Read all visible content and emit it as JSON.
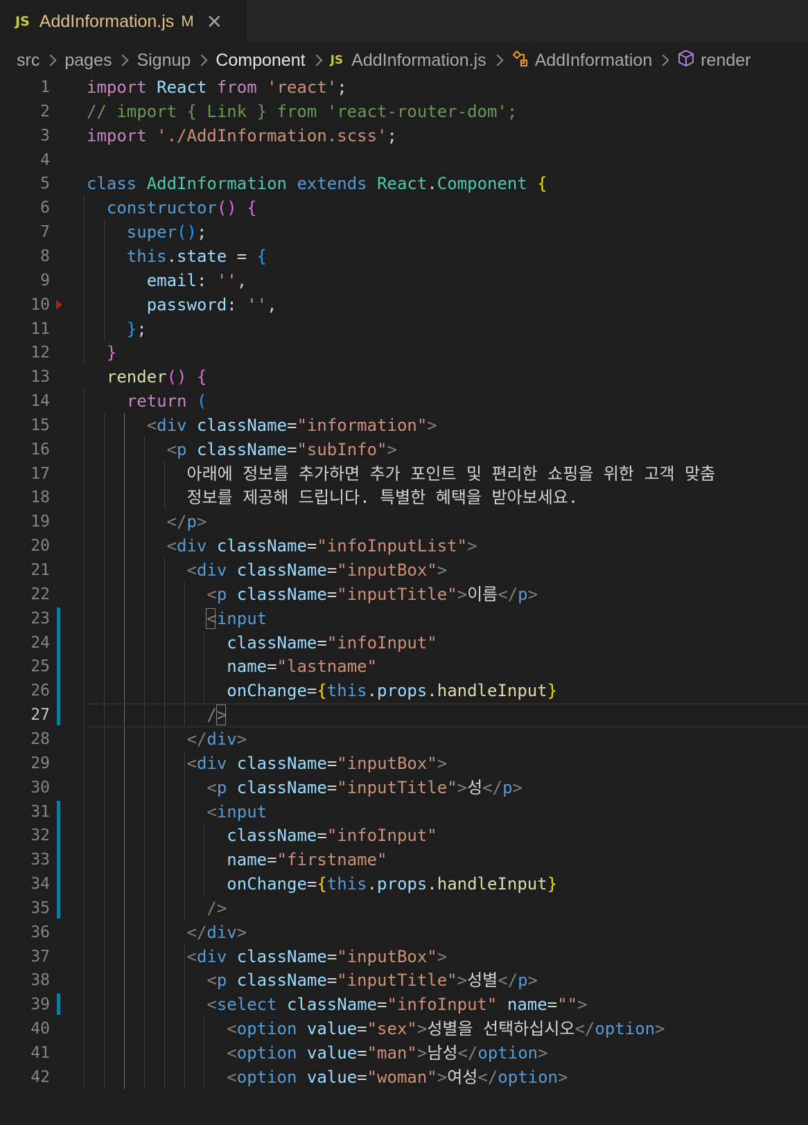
{
  "tab": {
    "icon_label": "JS",
    "title": "AddInformation.js",
    "modified_badge": "M",
    "close_icon": "close-icon"
  },
  "breadcrumb": {
    "items": [
      "src",
      "pages",
      "Signup",
      "Component",
      "AddInformation.js",
      "AddInformation",
      "render"
    ],
    "file_icon_label": "JS",
    "class_icon": "class-symbol-icon",
    "method_icon": "method-cube-icon"
  },
  "colors": {
    "background": "#1e1e1e",
    "tab_modified": "#e2c08d",
    "gutter_modified": "#0c7d9d",
    "js_icon": "#cbcb41"
  },
  "editor": {
    "active_line": 27,
    "lines": [
      "1",
      "2",
      "3",
      "4",
      "5",
      "6",
      "7",
      "8",
      "9",
      "10",
      "11",
      "12",
      "13",
      "14",
      "15",
      "16",
      "17",
      "18",
      "19",
      "20",
      "21",
      "22",
      "23",
      "24",
      "25",
      "26",
      "27",
      "28",
      "29",
      "30",
      "31",
      "32",
      "33",
      "34",
      "35",
      "36",
      "37",
      "38",
      "39",
      "40",
      "41",
      "42"
    ],
    "tokens": [
      [
        [
          "kw",
          "import"
        ],
        [
          "pn",
          " "
        ],
        [
          "vr",
          "React"
        ],
        [
          "pn",
          " "
        ],
        [
          "kw",
          "from"
        ],
        [
          "pn",
          " "
        ],
        [
          "str",
          "'react'"
        ],
        [
          "pn",
          ";"
        ]
      ],
      [
        [
          "com",
          "// import { Link } from 'react-router-dom';"
        ]
      ],
      [
        [
          "kw",
          "import"
        ],
        [
          "pn",
          " "
        ],
        [
          "str",
          "'./AddInformation.scss'"
        ],
        [
          "pn",
          ";"
        ]
      ],
      [],
      [
        [
          "kb",
          "class"
        ],
        [
          "pn",
          " "
        ],
        [
          "cls",
          "AddInformation"
        ],
        [
          "pn",
          " "
        ],
        [
          "kb",
          "extends"
        ],
        [
          "pn",
          " "
        ],
        [
          "cls",
          "React"
        ],
        [
          "pn",
          "."
        ],
        [
          "cls",
          "Component"
        ],
        [
          "pn",
          " "
        ],
        [
          "b1",
          "{"
        ]
      ],
      [
        [
          "pn",
          "  "
        ],
        [
          "kb",
          "constructor"
        ],
        [
          "b2",
          "()"
        ],
        [
          "pn",
          " "
        ],
        [
          "b2",
          "{"
        ]
      ],
      [
        [
          "pn",
          "    "
        ],
        [
          "kb",
          "super"
        ],
        [
          "b3",
          "()"
        ],
        [
          "pn",
          ";"
        ]
      ],
      [
        [
          "pn",
          "    "
        ],
        [
          "kb",
          "this"
        ],
        [
          "pn",
          "."
        ],
        [
          "vr",
          "state"
        ],
        [
          "pn",
          " = "
        ],
        [
          "b3",
          "{"
        ]
      ],
      [
        [
          "pn",
          "      "
        ],
        [
          "vr",
          "email"
        ],
        [
          "pn",
          ": "
        ],
        [
          "str",
          "''"
        ],
        [
          "pn",
          ","
        ]
      ],
      [
        [
          "pn",
          "      "
        ],
        [
          "vr",
          "password"
        ],
        [
          "pn",
          ": "
        ],
        [
          "str",
          "''"
        ],
        [
          "pn",
          ","
        ]
      ],
      [
        [
          "pn",
          "    "
        ],
        [
          "b3",
          "}"
        ],
        [
          "pn",
          ";"
        ]
      ],
      [
        [
          "pn",
          "  "
        ],
        [
          "b2",
          "}"
        ]
      ],
      [
        [
          "pn",
          "  "
        ],
        [
          "fn",
          "render"
        ],
        [
          "b2",
          "()"
        ],
        [
          "pn",
          " "
        ],
        [
          "b2",
          "{"
        ]
      ],
      [
        [
          "pn",
          "    "
        ],
        [
          "kw",
          "return"
        ],
        [
          "pn",
          " "
        ],
        [
          "b3",
          "("
        ]
      ],
      [
        [
          "pn",
          "      "
        ],
        [
          "ang",
          "<"
        ],
        [
          "tag",
          "div"
        ],
        [
          "pn",
          " "
        ],
        [
          "attr",
          "className"
        ],
        [
          "pn",
          "="
        ],
        [
          "str",
          "\"information\""
        ],
        [
          "ang",
          ">"
        ]
      ],
      [
        [
          "pn",
          "        "
        ],
        [
          "ang",
          "<"
        ],
        [
          "tag",
          "p"
        ],
        [
          "pn",
          " "
        ],
        [
          "attr",
          "className"
        ],
        [
          "pn",
          "="
        ],
        [
          "str",
          "\"subInfo\""
        ],
        [
          "ang",
          ">"
        ]
      ],
      [
        [
          "pn",
          "          "
        ],
        [
          "txt",
          "아래에 정보를 추가하면 추가 포인트 및 편리한 쇼핑을 위한 고객 맞춤"
        ]
      ],
      [
        [
          "pn",
          "          "
        ],
        [
          "txt",
          "정보를 제공해 드립니다. 특별한 혜택을 받아보세요."
        ]
      ],
      [
        [
          "pn",
          "        "
        ],
        [
          "ang",
          "</"
        ],
        [
          "tag",
          "p"
        ],
        [
          "ang",
          ">"
        ]
      ],
      [
        [
          "pn",
          "        "
        ],
        [
          "ang",
          "<"
        ],
        [
          "tag",
          "div"
        ],
        [
          "pn",
          " "
        ],
        [
          "attr",
          "className"
        ],
        [
          "pn",
          "="
        ],
        [
          "str",
          "\"infoInputList\""
        ],
        [
          "ang",
          ">"
        ]
      ],
      [
        [
          "pn",
          "          "
        ],
        [
          "ang",
          "<"
        ],
        [
          "tag",
          "div"
        ],
        [
          "pn",
          " "
        ],
        [
          "attr",
          "className"
        ],
        [
          "pn",
          "="
        ],
        [
          "str",
          "\"inputBox\""
        ],
        [
          "ang",
          ">"
        ]
      ],
      [
        [
          "pn",
          "            "
        ],
        [
          "ang",
          "<"
        ],
        [
          "tag",
          "p"
        ],
        [
          "pn",
          " "
        ],
        [
          "attr",
          "className"
        ],
        [
          "pn",
          "="
        ],
        [
          "str",
          "\"inputTitle\""
        ],
        [
          "ang",
          ">"
        ],
        [
          "txt",
          "이름"
        ],
        [
          "ang",
          "</"
        ],
        [
          "tag",
          "p"
        ],
        [
          "ang",
          ">"
        ]
      ],
      [
        [
          "pn",
          "            "
        ],
        [
          "ang",
          "<"
        ],
        [
          "tag",
          "input"
        ]
      ],
      [
        [
          "pn",
          "              "
        ],
        [
          "attr",
          "className"
        ],
        [
          "pn",
          "="
        ],
        [
          "str",
          "\"infoInput\""
        ]
      ],
      [
        [
          "pn",
          "              "
        ],
        [
          "attr",
          "name"
        ],
        [
          "pn",
          "="
        ],
        [
          "str",
          "\"lastname\""
        ]
      ],
      [
        [
          "pn",
          "              "
        ],
        [
          "attr",
          "onChange"
        ],
        [
          "pn",
          "="
        ],
        [
          "b1",
          "{"
        ],
        [
          "kb",
          "this"
        ],
        [
          "pn",
          "."
        ],
        [
          "vr",
          "props"
        ],
        [
          "pn",
          "."
        ],
        [
          "fn",
          "handleInput"
        ],
        [
          "b1",
          "}"
        ]
      ],
      [
        [
          "pn",
          "            "
        ],
        [
          "ang",
          "/>"
        ]
      ],
      [
        [
          "pn",
          "          "
        ],
        [
          "ang",
          "</"
        ],
        [
          "tag",
          "div"
        ],
        [
          "ang",
          ">"
        ]
      ],
      [
        [
          "pn",
          "          "
        ],
        [
          "ang",
          "<"
        ],
        [
          "tag",
          "div"
        ],
        [
          "pn",
          " "
        ],
        [
          "attr",
          "className"
        ],
        [
          "pn",
          "="
        ],
        [
          "str",
          "\"inputBox\""
        ],
        [
          "ang",
          ">"
        ]
      ],
      [
        [
          "pn",
          "            "
        ],
        [
          "ang",
          "<"
        ],
        [
          "tag",
          "p"
        ],
        [
          "pn",
          " "
        ],
        [
          "attr",
          "className"
        ],
        [
          "pn",
          "="
        ],
        [
          "str",
          "\"inputTitle\""
        ],
        [
          "ang",
          ">"
        ],
        [
          "txt",
          "성"
        ],
        [
          "ang",
          "</"
        ],
        [
          "tag",
          "p"
        ],
        [
          "ang",
          ">"
        ]
      ],
      [
        [
          "pn",
          "            "
        ],
        [
          "ang",
          "<"
        ],
        [
          "tag",
          "input"
        ]
      ],
      [
        [
          "pn",
          "              "
        ],
        [
          "attr",
          "className"
        ],
        [
          "pn",
          "="
        ],
        [
          "str",
          "\"infoInput\""
        ]
      ],
      [
        [
          "pn",
          "              "
        ],
        [
          "attr",
          "name"
        ],
        [
          "pn",
          "="
        ],
        [
          "str",
          "\"firstname\""
        ]
      ],
      [
        [
          "pn",
          "              "
        ],
        [
          "attr",
          "onChange"
        ],
        [
          "pn",
          "="
        ],
        [
          "b1",
          "{"
        ],
        [
          "kb",
          "this"
        ],
        [
          "pn",
          "."
        ],
        [
          "vr",
          "props"
        ],
        [
          "pn",
          "."
        ],
        [
          "fn",
          "handleInput"
        ],
        [
          "b1",
          "}"
        ]
      ],
      [
        [
          "pn",
          "            "
        ],
        [
          "ang",
          "/>"
        ]
      ],
      [
        [
          "pn",
          "          "
        ],
        [
          "ang",
          "</"
        ],
        [
          "tag",
          "div"
        ],
        [
          "ang",
          ">"
        ]
      ],
      [
        [
          "pn",
          "          "
        ],
        [
          "ang",
          "<"
        ],
        [
          "tag",
          "div"
        ],
        [
          "pn",
          " "
        ],
        [
          "attr",
          "className"
        ],
        [
          "pn",
          "="
        ],
        [
          "str",
          "\"inputBox\""
        ],
        [
          "ang",
          ">"
        ]
      ],
      [
        [
          "pn",
          "            "
        ],
        [
          "ang",
          "<"
        ],
        [
          "tag",
          "p"
        ],
        [
          "pn",
          " "
        ],
        [
          "attr",
          "className"
        ],
        [
          "pn",
          "="
        ],
        [
          "str",
          "\"inputTitle\""
        ],
        [
          "ang",
          ">"
        ],
        [
          "txt",
          "성별"
        ],
        [
          "ang",
          "</"
        ],
        [
          "tag",
          "p"
        ],
        [
          "ang",
          ">"
        ]
      ],
      [
        [
          "pn",
          "            "
        ],
        [
          "ang",
          "<"
        ],
        [
          "tag",
          "select"
        ],
        [
          "pn",
          " "
        ],
        [
          "attr",
          "className"
        ],
        [
          "pn",
          "="
        ],
        [
          "str",
          "\"infoInput\""
        ],
        [
          "pn",
          " "
        ],
        [
          "attr",
          "name"
        ],
        [
          "pn",
          "="
        ],
        [
          "str",
          "\"\""
        ],
        [
          "ang",
          ">"
        ]
      ],
      [
        [
          "pn",
          "              "
        ],
        [
          "ang",
          "<"
        ],
        [
          "tag",
          "option"
        ],
        [
          "pn",
          " "
        ],
        [
          "attr",
          "value"
        ],
        [
          "pn",
          "="
        ],
        [
          "str",
          "\"sex\""
        ],
        [
          "ang",
          ">"
        ],
        [
          "txt",
          "성별을 선택하십시오"
        ],
        [
          "ang",
          "</"
        ],
        [
          "tag",
          "option"
        ],
        [
          "ang",
          ">"
        ]
      ],
      [
        [
          "pn",
          "              "
        ],
        [
          "ang",
          "<"
        ],
        [
          "tag",
          "option"
        ],
        [
          "pn",
          " "
        ],
        [
          "attr",
          "value"
        ],
        [
          "pn",
          "="
        ],
        [
          "str",
          "\"man\""
        ],
        [
          "ang",
          ">"
        ],
        [
          "txt",
          "남성"
        ],
        [
          "ang",
          "</"
        ],
        [
          "tag",
          "option"
        ],
        [
          "ang",
          ">"
        ]
      ],
      [
        [
          "pn",
          "              "
        ],
        [
          "ang",
          "<"
        ],
        [
          "tag",
          "option"
        ],
        [
          "pn",
          " "
        ],
        [
          "attr",
          "value"
        ],
        [
          "pn",
          "="
        ],
        [
          "str",
          "\"woman\""
        ],
        [
          "ang",
          ">"
        ],
        [
          "txt",
          "여성"
        ],
        [
          "ang",
          "</"
        ],
        [
          "tag",
          "option"
        ],
        [
          "ang",
          ">"
        ]
      ]
    ]
  }
}
